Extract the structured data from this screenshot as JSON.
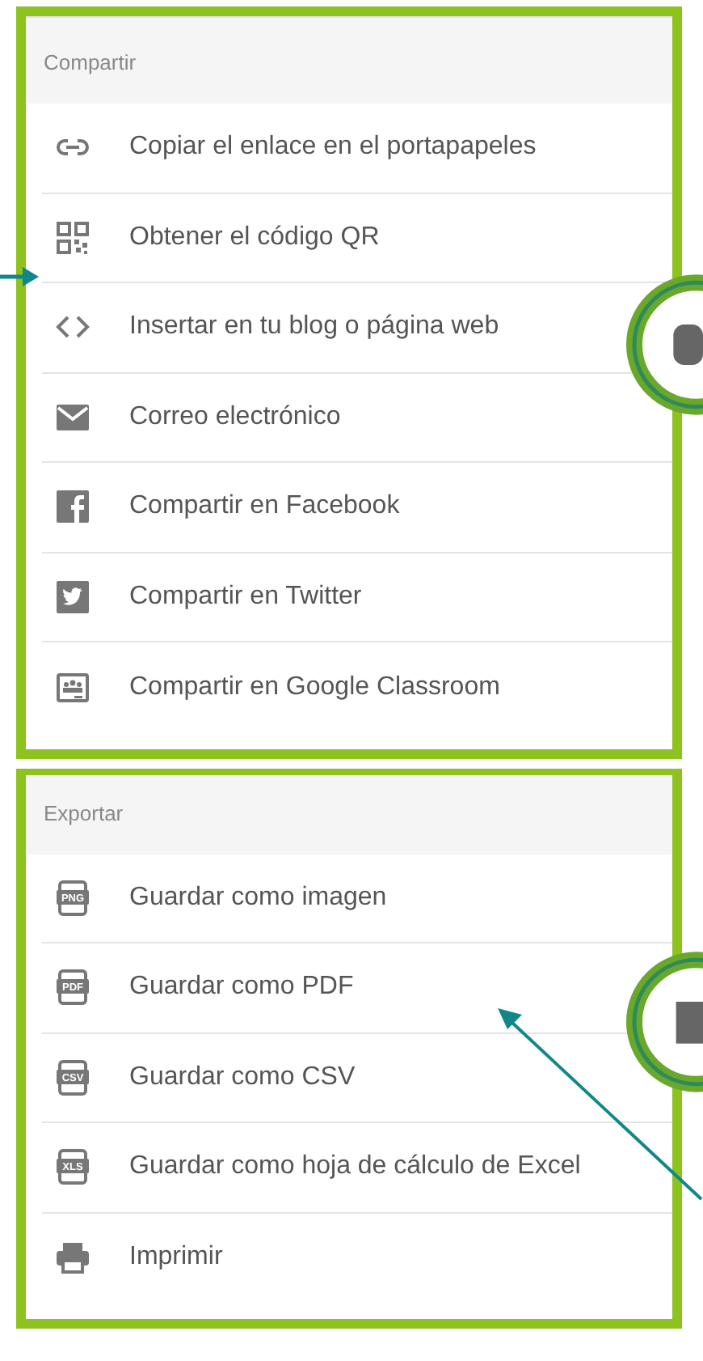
{
  "sections": [
    {
      "title": "Compartir",
      "items": [
        {
          "label": "Copiar el enlace en el portapapeles"
        },
        {
          "label": "Obtener el código QR"
        },
        {
          "label": "Insertar en tu blog o página web"
        },
        {
          "label": "Correo electrónico"
        },
        {
          "label": "Compartir en Facebook"
        },
        {
          "label": "Compartir en Twitter"
        },
        {
          "label": "Compartir en Google Classroom"
        }
      ]
    },
    {
      "title": "Exportar",
      "items": [
        {
          "icon_text": "PNG",
          "label": "Guardar como imagen"
        },
        {
          "icon_text": "PDF",
          "label": "Guardar como PDF"
        },
        {
          "icon_text": "CSV",
          "label": "Guardar como CSV"
        },
        {
          "icon_text": "XLS",
          "label": "Guardar como hoja de cálculo de Excel"
        },
        {
          "label": "Imprimir"
        }
      ]
    }
  ]
}
